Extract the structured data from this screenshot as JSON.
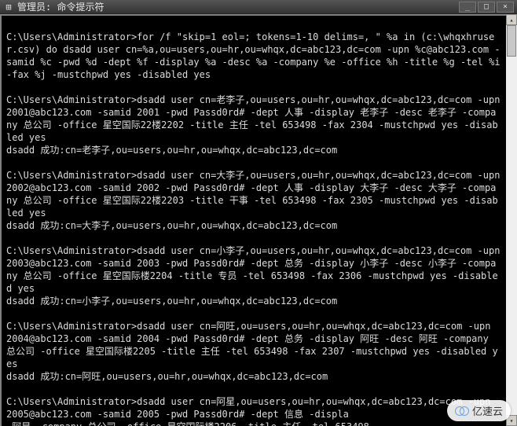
{
  "window": {
    "icon_glyph": "⊞",
    "title": "管理员: 命令提示符",
    "min_label": "_",
    "max_label": "□",
    "close_label": "×"
  },
  "prompt": "C:\\Users\\Administrator>",
  "for_cmd": "for /f \"skip=1 eol=; tokens=1-10 delims=, \" %a in (c:\\whqxhruser.csv) do dsadd user cn=%a,ou=users,ou=hr,ou=whqx,dc=abc123,dc=com -upn %c@abc123.com -samid %c -pwd %d -dept %f -display %a -desc %a -company %e -office %h -title %g -tel %i -fax %j -mustchpwd yes -disabled yes",
  "entries": [
    {
      "cmd": "dsadd user cn=老李子,ou=users,ou=hr,ou=whqx,dc=abc123,dc=com -upn 2001@abc123.com -samid 2001 -pwd Passd0rd# -dept 人事 -display 老李子 -desc 老李子 -company 总公司 -office 星空国际22楼2202 -title 主任 -tel 653498 -fax 2304 -mustchpwd yes -disabled yes",
      "ok": "dsadd 成功:cn=老李子,ou=users,ou=hr,ou=whqx,dc=abc123,dc=com"
    },
    {
      "cmd": "dsadd user cn=大李子,ou=users,ou=hr,ou=whqx,dc=abc123,dc=com -upn 2002@abc123.com -samid 2002 -pwd Passd0rd# -dept 人事 -display 大李子 -desc 大李子 -company 总公司 -office 星空国际22楼2203 -title 干事 -tel 653498 -fax 2305 -mustchpwd yes -disabled yes",
      "ok": "dsadd 成功:cn=大李子,ou=users,ou=hr,ou=whqx,dc=abc123,dc=com"
    },
    {
      "cmd": "dsadd user cn=小李子,ou=users,ou=hr,ou=whqx,dc=abc123,dc=com -upn 2003@abc123.com -samid 2003 -pwd Passd0rd# -dept 总务 -display 小李子 -desc 小李子 -company 总公司 -office 星空国际楼2204 -title 专员 -tel 653498 -fax 2306 -mustchpwd yes -disabled yes",
      "ok": "dsadd 成功:cn=小李子,ou=users,ou=hr,ou=whqx,dc=abc123,dc=com"
    },
    {
      "cmd": "dsadd user cn=阿旺,ou=users,ou=hr,ou=whqx,dc=abc123,dc=com -upn 2004@abc123.com -samid 2004 -pwd Passd0rd# -dept 总务 -display 阿旺 -desc 阿旺 -company 总公司 -office 星空国际楼2205 -title 主任 -tel 653498 -fax 2307 -mustchpwd yes -disabled yes",
      "ok": "dsadd 成功:cn=阿旺,ou=users,ou=hr,ou=whqx,dc=abc123,dc=com"
    }
  ],
  "partial": {
    "cmd": "dsadd user cn=阿星,ou=users,ou=hr,ou=whqx,dc=abc123,dc=com -upn 2005@abc123.com -samid 2005 -pwd Passd0rd# -dept 信息 -displa",
    "cut": " 阿星 -company 总公司 -office 星空国际楼2206 -title 主任 -tel 653498"
  },
  "watermark": {
    "text": "亿速云"
  }
}
